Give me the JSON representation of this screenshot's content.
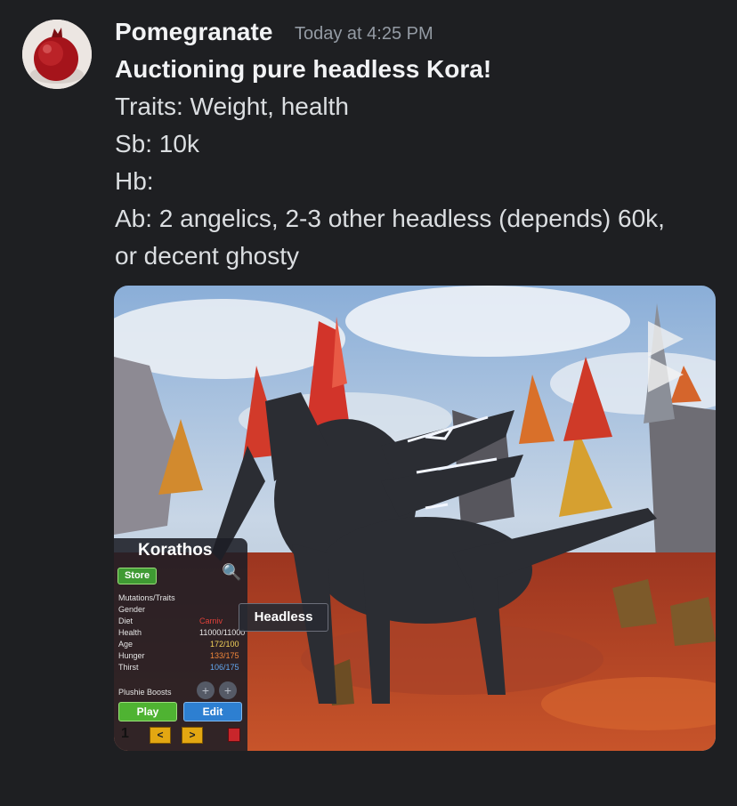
{
  "message": {
    "author": "Pomegranate",
    "timestamp": "Today at 4:25 PM",
    "lines": [
      "Auctioning pure headless Kora!",
      "Traits: Weight, health",
      "Sb: 10k",
      "Hb:",
      "Ab: 2 angelics, 2-3 other headless (depends) 60k,",
      "or decent ghosty"
    ]
  },
  "game_hud": {
    "creature_name": "Korathos",
    "store_label": "Store",
    "stats": [
      {
        "label": "Mutations/Traits",
        "value": ""
      },
      {
        "label": "Gender",
        "value": ""
      },
      {
        "label": "Diet",
        "value": "Carniv"
      },
      {
        "label": "Health",
        "value": "11000/11000"
      },
      {
        "label": "Age",
        "value": "172/100"
      },
      {
        "label": "Hunger",
        "value": "133/175"
      },
      {
        "label": "Thirst",
        "value": "106/175"
      }
    ],
    "plushie_boosts_label": "Plushie Boosts",
    "play_label": "Play",
    "edit_label": "Edit",
    "prev_label": "<",
    "next_label": ">",
    "slot_number": "1",
    "tooltip": "Headless"
  },
  "colors": {
    "background": "#1e1f22",
    "name": "#f2f3f5",
    "timestamp": "#949ba4",
    "text": "#dbdee1"
  }
}
